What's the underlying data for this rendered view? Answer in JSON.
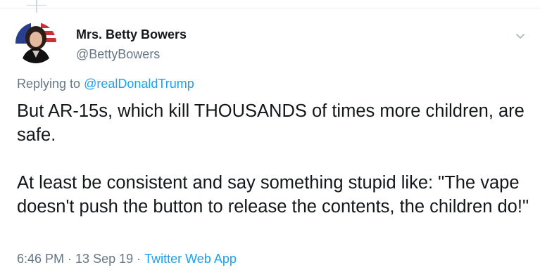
{
  "tweet": {
    "author": {
      "name": "Mrs. Betty Bowers",
      "handle": "@BettyBowers"
    },
    "reply": {
      "prefix": "Replying to",
      "handle": "@realDonaldTrump"
    },
    "body": {
      "paragraph1": "But AR-15s, which kill THOUSANDS of times more children, are safe.",
      "paragraph2": "At least be consistent and say something stupid like: \"The vape doesn't push the button to release the contents, the children do!\""
    },
    "meta": {
      "time": "6:46 PM",
      "separator": "·",
      "date": "13 Sep 19",
      "source": "Twitter Web App"
    }
  },
  "colors": {
    "text": "#14171a",
    "secondary": "#657786",
    "link": "#1da1f2",
    "divider": "#e6ecf0"
  },
  "icons": {
    "menu": "chevron-down-icon",
    "avatar": "avatar"
  }
}
